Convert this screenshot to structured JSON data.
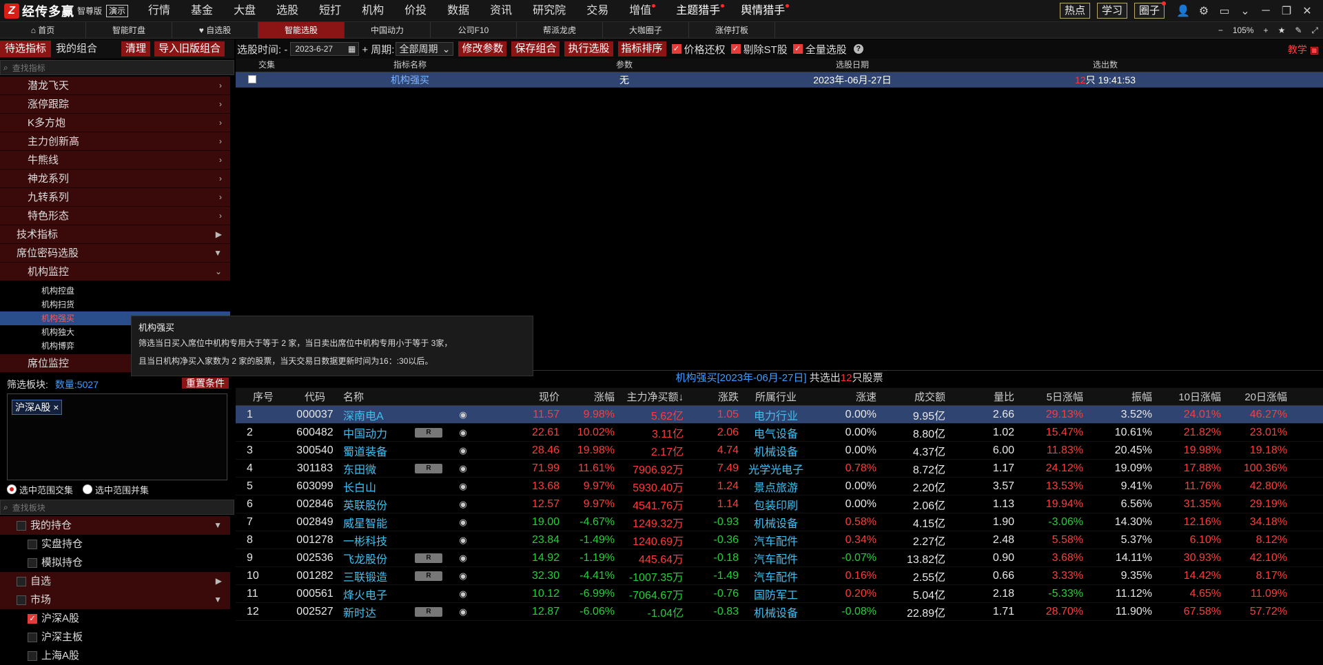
{
  "app": {
    "logo_letter": "Z",
    "name": "经传多赢",
    "edition": "智尊版",
    "demo": "演示"
  },
  "menu": [
    "行情",
    "基金",
    "大盘",
    "选股",
    "短打",
    "机构",
    "价投",
    "数据",
    "资讯",
    "研究院",
    "交易",
    "增值",
    "主题猎手",
    "舆情猎手"
  ],
  "right_buttons": [
    "热点",
    "学习",
    "圈子"
  ],
  "tabs": [
    "首页",
    "智能盯盘",
    "♥ 自选股",
    "智能选股",
    "中国动力",
    "公司F10",
    "帮派龙虎",
    "大咖圈子",
    "涨停打板"
  ],
  "zoom": {
    "minus": "−",
    "value": "105%",
    "plus": "+"
  },
  "left": {
    "tab_pending": "待选指标",
    "tab_mine": "我的组合",
    "btn_clear": "清理",
    "btn_import": "导入旧版组合",
    "search_placeholder": "查找指标",
    "tree_nodes": [
      "潜龙飞天",
      "涨停跟踪",
      "K多方炮",
      "主力创新高",
      "牛熊线",
      "神龙系列",
      "九转系列",
      "特色形态"
    ],
    "section_tech": "技术指标",
    "section_seat": "席位密码选股",
    "node_inst": "机构监控",
    "leaves": [
      "机构控盘",
      "机构扫货",
      "机构强买",
      "机构独大",
      "机构博弈"
    ],
    "node_seat_monitor": "席位监控",
    "filter_label": "筛选板块:",
    "filter_count": "数量:5027",
    "reset_btn": "重置条件",
    "tag": "沪深A股 ×",
    "radio1": "选中范围交集",
    "radio2": "选中范围并集",
    "search2_placeholder": "查找板块",
    "board_my": "我的持仓",
    "board_real": "实盘持仓",
    "board_sim": "模拟持仓",
    "board_self": "自选",
    "board_market": "市场",
    "board_hs": "沪深A股",
    "board_main": "沪深主板",
    "board_sh": "上海A股"
  },
  "toolbar": {
    "time_label": "选股时间: -",
    "date": "2023-6-27",
    "period_label": "+ 周期:",
    "period": "全部周期",
    "btn_modify": "修改参数",
    "btn_save": "保存组合",
    "btn_run": "执行选股",
    "btn_sort": "指标排序",
    "cb_price": "价格还权",
    "cb_st": "剔除ST股",
    "cb_all": "全量选股",
    "help": "?",
    "teach": "教学"
  },
  "top_table": {
    "headers": [
      "交集",
      "指标名称",
      "参数",
      "选股日期",
      "选出数"
    ],
    "row": {
      "name": "机构强买",
      "param": "无",
      "date": "2023年-06月-27日",
      "count": "12",
      "count_suffix": "只 19:41:53"
    }
  },
  "tooltip": {
    "title": "机构强买",
    "line1": "筛选当日买入席位中机构专用大于等于 2 家，当日卖出席位中机构专用小于等于 3家，",
    "line2": "且当日机构净买入家数为 2 家的股票，当天交易日数据更新时间为16：:30以后。"
  },
  "result_title": {
    "prefix": "机构强买[2023年-06月-27日]",
    "mid": " 共选出",
    "count": "12",
    "suffix": "只股票"
  },
  "grid": {
    "headers": [
      "序号",
      "代码",
      "名称",
      "",
      "",
      "现价",
      "涨幅",
      "主力净买额↓",
      "涨跌",
      "所属行业",
      "涨速",
      "成交额",
      "量比",
      "5日涨幅",
      "振幅",
      "10日涨幅",
      "20日涨幅"
    ],
    "rows": [
      {
        "no": "1",
        "code": "000037",
        "name": "深南电A",
        "r": false,
        "price": "11.57",
        "chg": "9.98%",
        "net": "5.62亿",
        "diff": "1.05",
        "ind": "电力行业",
        "spd": "0.00%",
        "amt": "9.95亿",
        "vr": "2.66",
        "d5": "29.13%",
        "amp": "3.52%",
        "d10": "24.01%",
        "d20": "46.27%",
        "s": "up",
        "spd_s": "flat",
        "d5_s": "up",
        "d10_s": "up",
        "d20_s": "up"
      },
      {
        "no": "2",
        "code": "600482",
        "name": "中国动力",
        "r": true,
        "price": "22.61",
        "chg": "10.02%",
        "net": "3.11亿",
        "diff": "2.06",
        "ind": "电气设备",
        "spd": "0.00%",
        "amt": "8.80亿",
        "vr": "1.02",
        "d5": "15.47%",
        "amp": "10.61%",
        "d10": "21.82%",
        "d20": "23.01%",
        "s": "up",
        "spd_s": "flat",
        "d5_s": "up",
        "d10_s": "up",
        "d20_s": "up"
      },
      {
        "no": "3",
        "code": "300540",
        "name": "蜀道装备",
        "r": false,
        "price": "28.46",
        "chg": "19.98%",
        "net": "2.17亿",
        "diff": "4.74",
        "ind": "机械设备",
        "spd": "0.00%",
        "amt": "4.37亿",
        "vr": "6.00",
        "d5": "11.83%",
        "amp": "20.45%",
        "d10": "19.98%",
        "d20": "19.18%",
        "s": "up",
        "spd_s": "flat",
        "d5_s": "up",
        "d10_s": "up",
        "d20_s": "up"
      },
      {
        "no": "4",
        "code": "301183",
        "name": "东田微",
        "r": true,
        "price": "71.99",
        "chg": "11.61%",
        "net": "7906.92万",
        "diff": "7.49",
        "ind": "光学光电子",
        "spd": "0.78%",
        "amt": "8.72亿",
        "vr": "1.17",
        "d5": "24.12%",
        "amp": "19.09%",
        "d10": "17.88%",
        "d20": "100.36%",
        "s": "up",
        "spd_s": "up",
        "d5_s": "up",
        "d10_s": "up",
        "d20_s": "up"
      },
      {
        "no": "5",
        "code": "603099",
        "name": "长白山",
        "r": false,
        "price": "13.68",
        "chg": "9.97%",
        "net": "5930.40万",
        "diff": "1.24",
        "ind": "景点旅游",
        "spd": "0.00%",
        "amt": "2.20亿",
        "vr": "3.57",
        "d5": "13.53%",
        "amp": "9.41%",
        "d10": "11.76%",
        "d20": "42.80%",
        "s": "up",
        "spd_s": "flat",
        "d5_s": "up",
        "d10_s": "up",
        "d20_s": "up"
      },
      {
        "no": "6",
        "code": "002846",
        "name": "英联股份",
        "r": false,
        "price": "12.57",
        "chg": "9.97%",
        "net": "4541.76万",
        "diff": "1.14",
        "ind": "包装印刷",
        "spd": "0.00%",
        "amt": "2.06亿",
        "vr": "1.13",
        "d5": "19.94%",
        "amp": "6.56%",
        "d10": "31.35%",
        "d20": "29.19%",
        "s": "up",
        "spd_s": "flat",
        "d5_s": "up",
        "d10_s": "up",
        "d20_s": "up"
      },
      {
        "no": "7",
        "code": "002849",
        "name": "威星智能",
        "r": false,
        "price": "19.00",
        "chg": "-4.67%",
        "net": "1249.32万",
        "diff": "-0.93",
        "ind": "机械设备",
        "spd": "0.58%",
        "amt": "4.15亿",
        "vr": "1.90",
        "d5": "-3.06%",
        "amp": "14.30%",
        "d10": "12.16%",
        "d20": "34.18%",
        "s": "down",
        "spd_s": "up",
        "d5_s": "down",
        "d10_s": "up",
        "d20_s": "up"
      },
      {
        "no": "8",
        "code": "001278",
        "name": "一彬科技",
        "r": false,
        "price": "23.84",
        "chg": "-1.49%",
        "net": "1240.69万",
        "diff": "-0.36",
        "ind": "汽车配件",
        "spd": "0.34%",
        "amt": "2.27亿",
        "vr": "2.48",
        "d5": "5.58%",
        "amp": "5.37%",
        "d10": "6.10%",
        "d20": "8.12%",
        "s": "down",
        "spd_s": "up",
        "d5_s": "up",
        "d10_s": "up",
        "d20_s": "up"
      },
      {
        "no": "9",
        "code": "002536",
        "name": "飞龙股份",
        "r": true,
        "price": "14.92",
        "chg": "-1.19%",
        "net": "445.64万",
        "diff": "-0.18",
        "ind": "汽车配件",
        "spd": "-0.07%",
        "amt": "13.82亿",
        "vr": "0.90",
        "d5": "3.68%",
        "amp": "14.11%",
        "d10": "30.93%",
        "d20": "42.10%",
        "s": "down",
        "spd_s": "down",
        "d5_s": "up",
        "d10_s": "up",
        "d20_s": "up"
      },
      {
        "no": "10",
        "code": "001282",
        "name": "三联锻造",
        "r": true,
        "price": "32.30",
        "chg": "-4.41%",
        "net": "-1007.35万",
        "diff": "-1.49",
        "ind": "汽车配件",
        "spd": "0.16%",
        "amt": "2.55亿",
        "vr": "0.66",
        "d5": "3.33%",
        "amp": "9.35%",
        "d10": "14.42%",
        "d20": "8.17%",
        "s": "down",
        "spd_s": "up",
        "d5_s": "up",
        "d10_s": "up",
        "d20_s": "up"
      },
      {
        "no": "11",
        "code": "000561",
        "name": "烽火电子",
        "r": false,
        "price": "10.12",
        "chg": "-6.99%",
        "net": "-7064.67万",
        "diff": "-0.76",
        "ind": "国防军工",
        "spd": "0.20%",
        "amt": "5.04亿",
        "vr": "2.18",
        "d5": "-5.33%",
        "amp": "11.12%",
        "d10": "4.65%",
        "d20": "11.09%",
        "s": "down",
        "spd_s": "up",
        "d5_s": "down",
        "d10_s": "up",
        "d20_s": "up"
      },
      {
        "no": "12",
        "code": "002527",
        "name": "新时达",
        "r": true,
        "price": "12.87",
        "chg": "-6.06%",
        "net": "-1.04亿",
        "diff": "-0.83",
        "ind": "机械设备",
        "spd": "-0.08%",
        "amt": "22.89亿",
        "vr": "1.71",
        "d5": "28.70%",
        "amp": "11.90%",
        "d10": "67.58%",
        "d20": "57.72%",
        "s": "down",
        "spd_s": "down",
        "d5_s": "up",
        "d10_s": "up",
        "d20_s": "up"
      }
    ]
  },
  "colors": {
    "accent": "#8b1515",
    "up": "#ff3b3b",
    "down": "#22d13a",
    "link": "#3fc0f0",
    "select": "#2f4470"
  }
}
